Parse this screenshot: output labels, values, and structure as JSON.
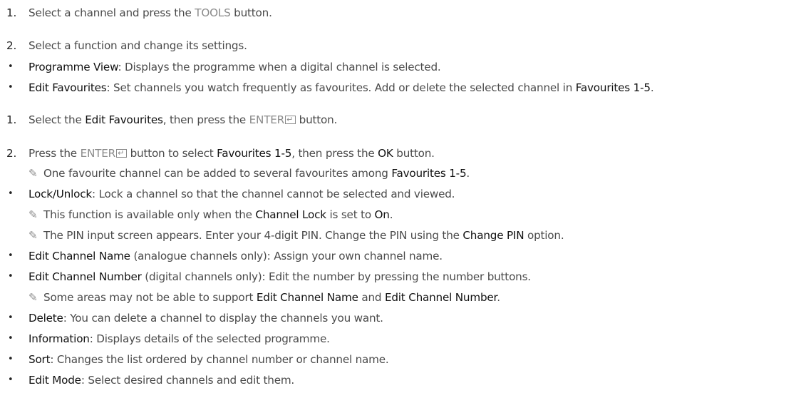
{
  "glyphs": {
    "bullet": "•",
    "note": "✎"
  },
  "s1": {
    "num": "1.",
    "a": "Select a channel and press the ",
    "k": "TOOLS",
    "b": " button."
  },
  "s2": {
    "num": "2.",
    "a": "Select a function and change its settings."
  },
  "b_prog": {
    "t": "Programme View",
    "a": ": Displays the programme when a digital channel is selected."
  },
  "b_fav": {
    "t": "Edit Favourites",
    "a": ": Set channels you watch frequently as favourites. Add or delete the selected channel in ",
    "t2": "Favourites 1-5",
    "b": "."
  },
  "f1": {
    "num": "1.",
    "a": "Select the ",
    "t": "Edit Favourites",
    "b": ", then press the ",
    "k": "ENTER",
    "c": " button."
  },
  "f2": {
    "num": "2.",
    "a": "Press the ",
    "k": "ENTER",
    "b": " button to select ",
    "t": "Favourites 1-5",
    "c": ", then press the ",
    "t2": "OK",
    "d": " button."
  },
  "n_fav": {
    "a": "One favourite channel can be added to several favourites among ",
    "t": "Favourites 1-5",
    "b": "."
  },
  "b_lock": {
    "t": "Lock/Unlock",
    "a": ": Lock a channel so that the channel cannot be selected and viewed."
  },
  "n_lock1": {
    "a": "This function is available only when the ",
    "t": "Channel Lock",
    "b": " is set to ",
    "t2": "On",
    "c": "."
  },
  "n_lock2": {
    "a": "The PIN input screen appears. Enter your 4-digit PIN. Change the PIN using the ",
    "t": "Change PIN",
    "b": " option."
  },
  "b_name": {
    "t": "Edit Channel Name",
    "a": " (analogue channels only): Assign your own channel name."
  },
  "b_number": {
    "t": "Edit Channel Number",
    "a": " (digital channels only): Edit the number by pressing the number buttons."
  },
  "n_areas": {
    "a": "Some areas may not be able to support ",
    "t": "Edit Channel Name",
    "b": " and ",
    "t2": "Edit Channel Number",
    "c": "."
  },
  "b_delete": {
    "t": "Delete",
    "a": ": You can delete a channel to display the channels you want."
  },
  "b_info": {
    "t": "Information",
    "a": ": Displays details of the selected programme."
  },
  "b_sort": {
    "t": "Sort",
    "a": ": Changes the list ordered by channel number or channel name."
  },
  "b_edit": {
    "t": "Edit Mode",
    "a": ": Select desired channels and edit them."
  }
}
